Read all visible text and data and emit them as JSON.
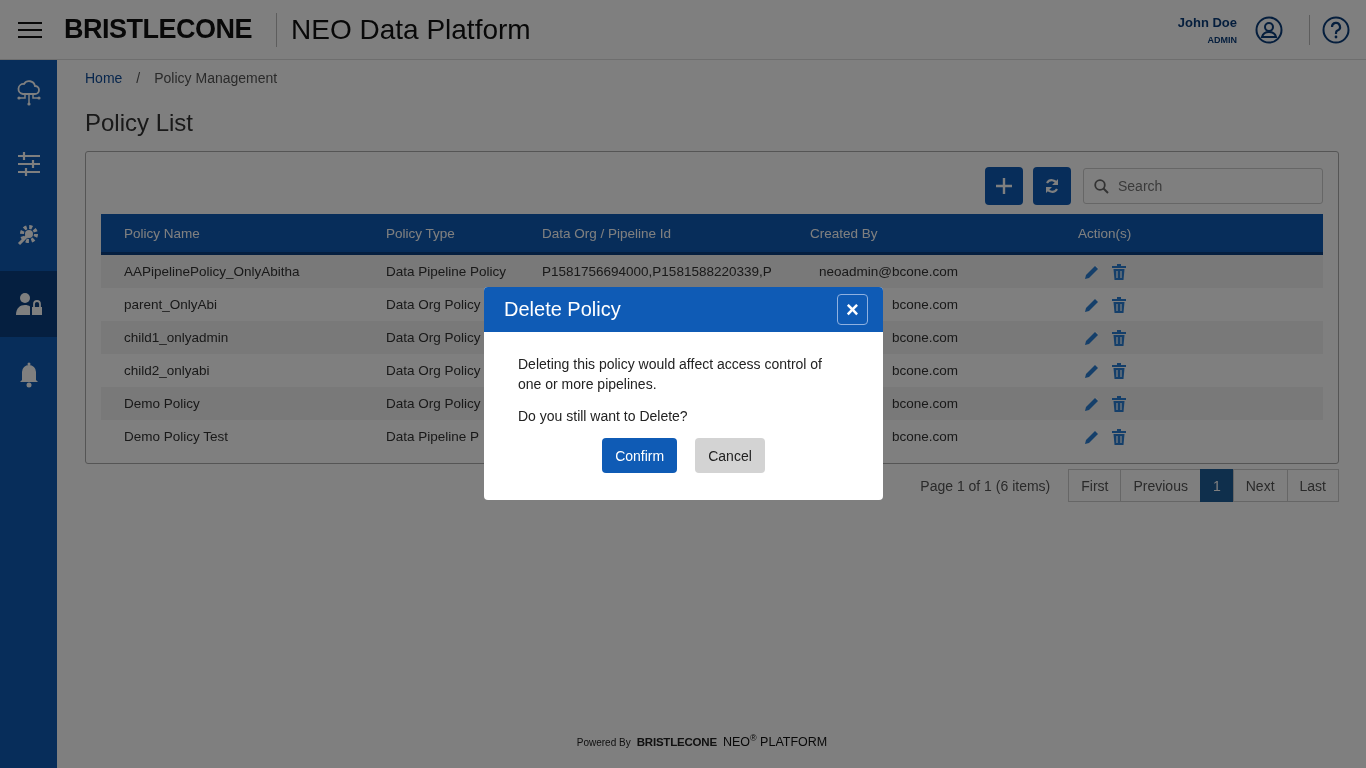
{
  "header": {
    "brand": "BRISTLECONE",
    "app_title": "NEO Data Platform",
    "user_name": "John Doe",
    "user_role": "ADMIN"
  },
  "sidebar": {
    "items": [
      {
        "kind": "cloud",
        "selected": false
      },
      {
        "kind": "pipeline",
        "selected": false
      },
      {
        "kind": "settings",
        "selected": false
      },
      {
        "kind": "user-lock",
        "selected": true
      },
      {
        "kind": "bell",
        "selected": false
      }
    ]
  },
  "breadcrumb": [
    {
      "label": "Home",
      "kind": "link"
    },
    {
      "label": "/",
      "kind": "separator"
    },
    {
      "label": "Policy Management",
      "kind": "current"
    }
  ],
  "page_title": "Policy List",
  "search": {
    "placeholder": "Search"
  },
  "table": {
    "columns": [
      "Policy Name",
      "Policy Type",
      "Data Org / Pipeline Id",
      "Created By",
      "Action(s)"
    ],
    "rows": [
      {
        "name": "AAPipelinePolicy_OnlyAbitha",
        "type": "Data Pipeline Policy",
        "data_org": "P1581756694000,P1581588220339,P",
        "created_by": "neoadmin@bcone.com"
      },
      {
        "name": "parent_OnlyAbi",
        "type": "Data Org Policy",
        "created_by": "bcone.com"
      },
      {
        "name": "child1_onlyadmin",
        "type": "Data Org Policy",
        "created_by": "bcone.com"
      },
      {
        "name": "child2_onlyabi",
        "type": "Data Org Policy",
        "created_by": "bcone.com"
      },
      {
        "name": "Demo Policy",
        "type": "Data Org Policy",
        "created_by": "bcone.com"
      },
      {
        "name": "Demo Policy Test",
        "type": "Data Pipeline P",
        "created_by": "bcone.com"
      }
    ]
  },
  "pagination": {
    "summary": "Page 1 of 1 (6 items)",
    "pages": [
      {
        "label": "First",
        "selected": false
      },
      {
        "label": "Previous",
        "selected": false
      },
      {
        "label": "1",
        "selected": true
      },
      {
        "label": "Next",
        "selected": false
      },
      {
        "label": "Last",
        "selected": false
      }
    ]
  },
  "footer": {
    "powered_by": "Powered By",
    "brand": "BRISTLECONE",
    "product": "NEO$^{®}$ PLATFORM"
  },
  "dialog": {
    "title": "Delete Policy",
    "close": "×",
    "message": "Deleting this policy would affect access control of one or more pipelines.",
    "question": "Do you still want to Delete?",
    "buttons": [
      {
        "label": "Confirm",
        "kind": "primary"
      },
      {
        "label": "Cancel",
        "kind": "secondary"
      }
    ]
  }
}
